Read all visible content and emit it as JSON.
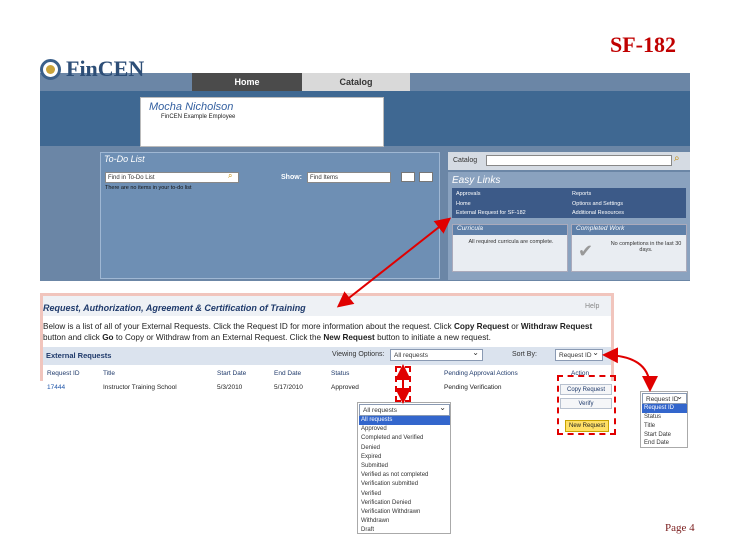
{
  "slide": {
    "code": "SF-182",
    "page": "Page 4"
  },
  "logo": {
    "name": "FinCEN"
  },
  "nav": {
    "tabs": [
      {
        "label": "Home"
      },
      {
        "label": "Catalog"
      }
    ]
  },
  "profile": {
    "name": "Mocha   Nicholson",
    "subtitle": "FinCEN Example Employee"
  },
  "todo": {
    "title": "To-Do List",
    "search_placeholder": "Find in To-Do List",
    "show_label": "Show:",
    "show_value": "Find Items",
    "empty_text": "There are no items in your to-do list"
  },
  "catalog": {
    "label": "Catalog"
  },
  "easy_links": {
    "title": "Easy Links",
    "items": [
      "Approvals",
      "Reports",
      "Home",
      "Options and Settings",
      "External Request for SF-182",
      "Additional Resources"
    ]
  },
  "curricula": {
    "title": "Curricula",
    "text": "All required curricula are complete."
  },
  "completed": {
    "title": "Completed Work",
    "text": "No completions in the last 30 days."
  },
  "requests": {
    "title": "Request, Authorization, Agreement & Certification of Training",
    "help": "Help",
    "desc1": "Below is a list of all of your External Requests. Click the Request ID for more information about the request. Click",
    "copy": "Copy Request",
    "or1": "or",
    "withdraw": "Withdraw Request",
    "desc2": "button and click",
    "go": "Go",
    "desc3": "to Copy or Withdraw from an External Request. Click the",
    "newreq": "New Request",
    "desc4": "button to initiate a new request.",
    "bar_title": "External Requests",
    "viewing_label": "Viewing Options:",
    "viewing_value": "All requests",
    "sort_label": "Sort By:",
    "sort_value": "Request ID",
    "columns": [
      "Request ID",
      "Title",
      "Start Date",
      "End Date",
      "Status",
      "Pending Approval Actions",
      "Action"
    ],
    "row": {
      "id": "17444",
      "title": "Instructor Training School",
      "start": "5/3/2010",
      "end": "5/17/2010",
      "status": "Approved",
      "pending": "Pending Verification"
    },
    "actions": {
      "copy": "Copy Request",
      "verify": "Verify",
      "new": "New Request"
    }
  },
  "status_dropdown": {
    "selected": "All requests",
    "options": [
      "All requests",
      "Approved",
      "Completed and Verified",
      "Denied",
      "Expired",
      "Submitted",
      "Verified as not completed",
      "Verification submitted",
      "Verified",
      "Verification Denied",
      "Verification Withdrawn",
      "Withdrawn",
      "Draft"
    ]
  },
  "sort_dropdown": {
    "selected": "Request ID",
    "options": [
      "Request ID",
      "Status",
      "Title",
      "Start Date",
      "End Date"
    ]
  }
}
